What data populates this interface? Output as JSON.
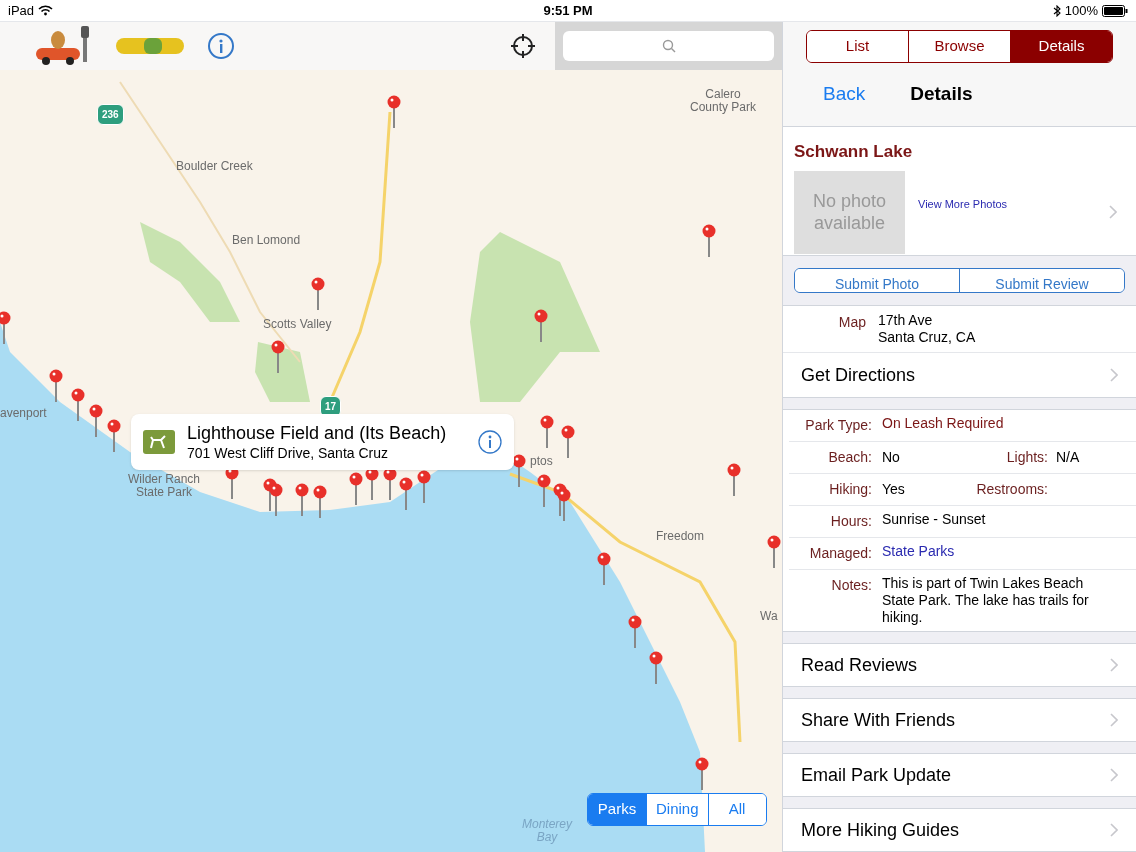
{
  "status_bar": {
    "carrier": "iPad",
    "time": "9:51 PM",
    "battery": "100%"
  },
  "map": {
    "labels": [
      "Calero\nCounty Park",
      "Boulder Creek",
      "Ben Lomond",
      "Scotts Valley",
      "avenport",
      "Wilder Ranch\nState Park",
      "ptos",
      "Freedom",
      "Wa",
      "Monterey\nBay"
    ],
    "shields": [
      "236",
      "17"
    ],
    "callout": {
      "title": "Lighthouse Field and (Its Beach)",
      "subtitle": "701 West Cliff Drive, Santa Cruz"
    },
    "filters": [
      {
        "label": "Parks",
        "selected": true
      },
      {
        "label": "Dining",
        "selected": false
      },
      {
        "label": "All",
        "selected": false
      }
    ]
  },
  "panel": {
    "tabs": [
      {
        "label": "List",
        "selected": false
      },
      {
        "label": "Browse",
        "selected": false
      },
      {
        "label": "Details",
        "selected": true
      }
    ],
    "back": "Back",
    "title": "Details",
    "place": {
      "name": "Schwann Lake",
      "photo": "No photo\navailable",
      "more_photos": "View More Photos"
    },
    "actions": [
      "Submit Photo",
      "Submit Review"
    ],
    "map_row": {
      "label": "Map",
      "address": "17th Ave\nSanta Cruz, CA"
    },
    "directions": "Get Directions",
    "facts": [
      {
        "kind": "accent",
        "label": "Park Type:",
        "value": "On Leash Required"
      },
      {
        "kind": "pair",
        "label": "Beach:",
        "value": "No",
        "label2": "Lights:",
        "value2": "N/A"
      },
      {
        "kind": "pair",
        "label": "Hiking:",
        "value": "Yes",
        "label2": "Restrooms:"
      },
      {
        "kind": "plain",
        "label": "Hours:",
        "value": "Sunrise - Sunset"
      },
      {
        "kind": "link",
        "label": "Managed:",
        "value": "State Parks"
      },
      {
        "kind": "plain",
        "label": "Notes:",
        "value": "This is part of Twin Lakes Beach State Park.  The lake has trails for hiking."
      }
    ],
    "links": [
      "Read Reviews",
      "Share With Friends",
      "Email Park Update",
      "More Hiking Guides"
    ]
  }
}
